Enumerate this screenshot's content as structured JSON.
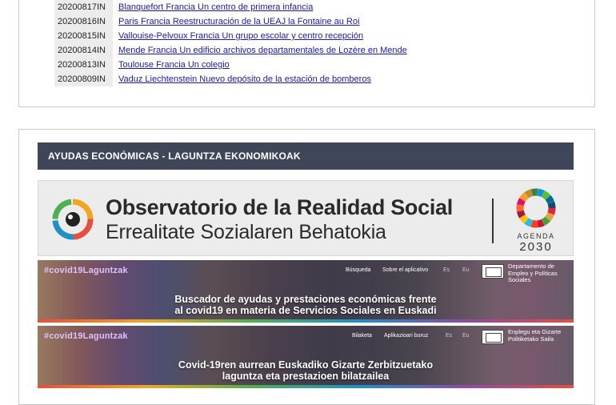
{
  "news_list": [
    {
      "date": "20200817IN",
      "title": "Blanquefort Francia Un centro de primera infancia"
    },
    {
      "date": "20200816IN",
      "title": "Paris Francia Reestructuración de la UEAJ la Fontaine au Roi"
    },
    {
      "date": "20200815IN",
      "title": "Vallouise-Pelvoux Francia Un grupo escolar y centro recepción"
    },
    {
      "date": "20200814IN",
      "title": "Mende Francia Un edificio archivos departamentales de Lozère en Mende"
    },
    {
      "date": "20200813IN",
      "title": "Toulouse Francia Un colegio"
    },
    {
      "date": "20200809IN",
      "title": "Vaduz Liechtenstein Nuevo depósito de la estación de bomberos"
    }
  ],
  "section": {
    "title": "AYUDAS ECONÓMICAS - LAGUNTZA EKONOMIKOAK"
  },
  "observatorio_banner": {
    "title": "Observatorio de la Realidad Social",
    "subtitle": "Errealitate Sozialaren Behatokia",
    "agenda_label": "AGENDA",
    "agenda_year": "2030",
    "icon": "observatorio-logo-icon"
  },
  "covid_banners": [
    {
      "tag": "#covid19Laguntzak",
      "nav": [
        "Búsqueda",
        "Sobre el aplicativo",
        "Es",
        "Eu"
      ],
      "department": "Departamento de Empleo y Políticas Sociales",
      "headline_line1": "Buscador de ayudas y prestaciones económicas frente",
      "headline_line2": "al covid19 en materia de Servicios Sociales en Euskadi"
    },
    {
      "tag": "#covid19Laguntzak",
      "nav": [
        "Bilaketa",
        "Aplikazioari buruz",
        "Es",
        "Eu"
      ],
      "department": "Enplegu eta Gizarte Politiketako Saila",
      "headline_line1": "Covid-19ren aurrean Euskadiko Gizarte Zerbitzuetako",
      "headline_line2": "laguntza eta prestazioen bilatzailea"
    }
  ],
  "colors": {
    "section_header_bg": "#3f4657",
    "link": "#1a1aa6",
    "date_bg": "#ececec"
  }
}
